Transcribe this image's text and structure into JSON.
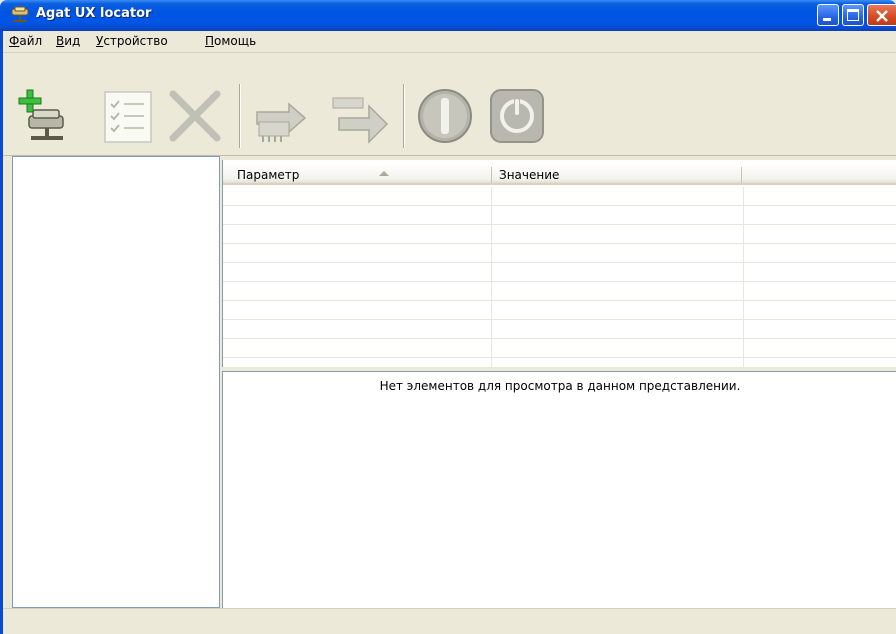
{
  "window": {
    "title": "Agat UX locator",
    "buttons": [
      "minimize",
      "maximize",
      "close"
    ]
  },
  "menu": {
    "items": [
      {
        "label": "Файл",
        "accel": "Ф",
        "rest": "айл"
      },
      {
        "label": "Вид",
        "accel": "В",
        "rest": "ид"
      },
      {
        "label": "Устройство",
        "accel": "У",
        "rest": "стройство"
      },
      {
        "label": "Помощь",
        "accel": "П",
        "rest": "омощь"
      }
    ]
  },
  "toolbar": {
    "buttons": [
      {
        "name": "add-device-icon",
        "enabled": true
      },
      {
        "name": "properties-list-icon",
        "enabled": false
      },
      {
        "name": "delete-icon",
        "enabled": false
      },
      {
        "name": "read-chip-icon",
        "enabled": false
      },
      {
        "name": "transfer-arrow-icon",
        "enabled": false
      },
      {
        "name": "stop-icon",
        "enabled": false
      },
      {
        "name": "power-icon",
        "enabled": false
      }
    ]
  },
  "properties": {
    "columns": [
      "Параметр",
      "Значение"
    ],
    "sorted_column": "Параметр",
    "rows": []
  },
  "listview": {
    "empty_message": "Нет элементов для просмотра в данном представлении."
  },
  "colors": {
    "titlebar": "#0054e3",
    "window_bg": "#ece9d8",
    "pane_border": "#7f9db9"
  }
}
